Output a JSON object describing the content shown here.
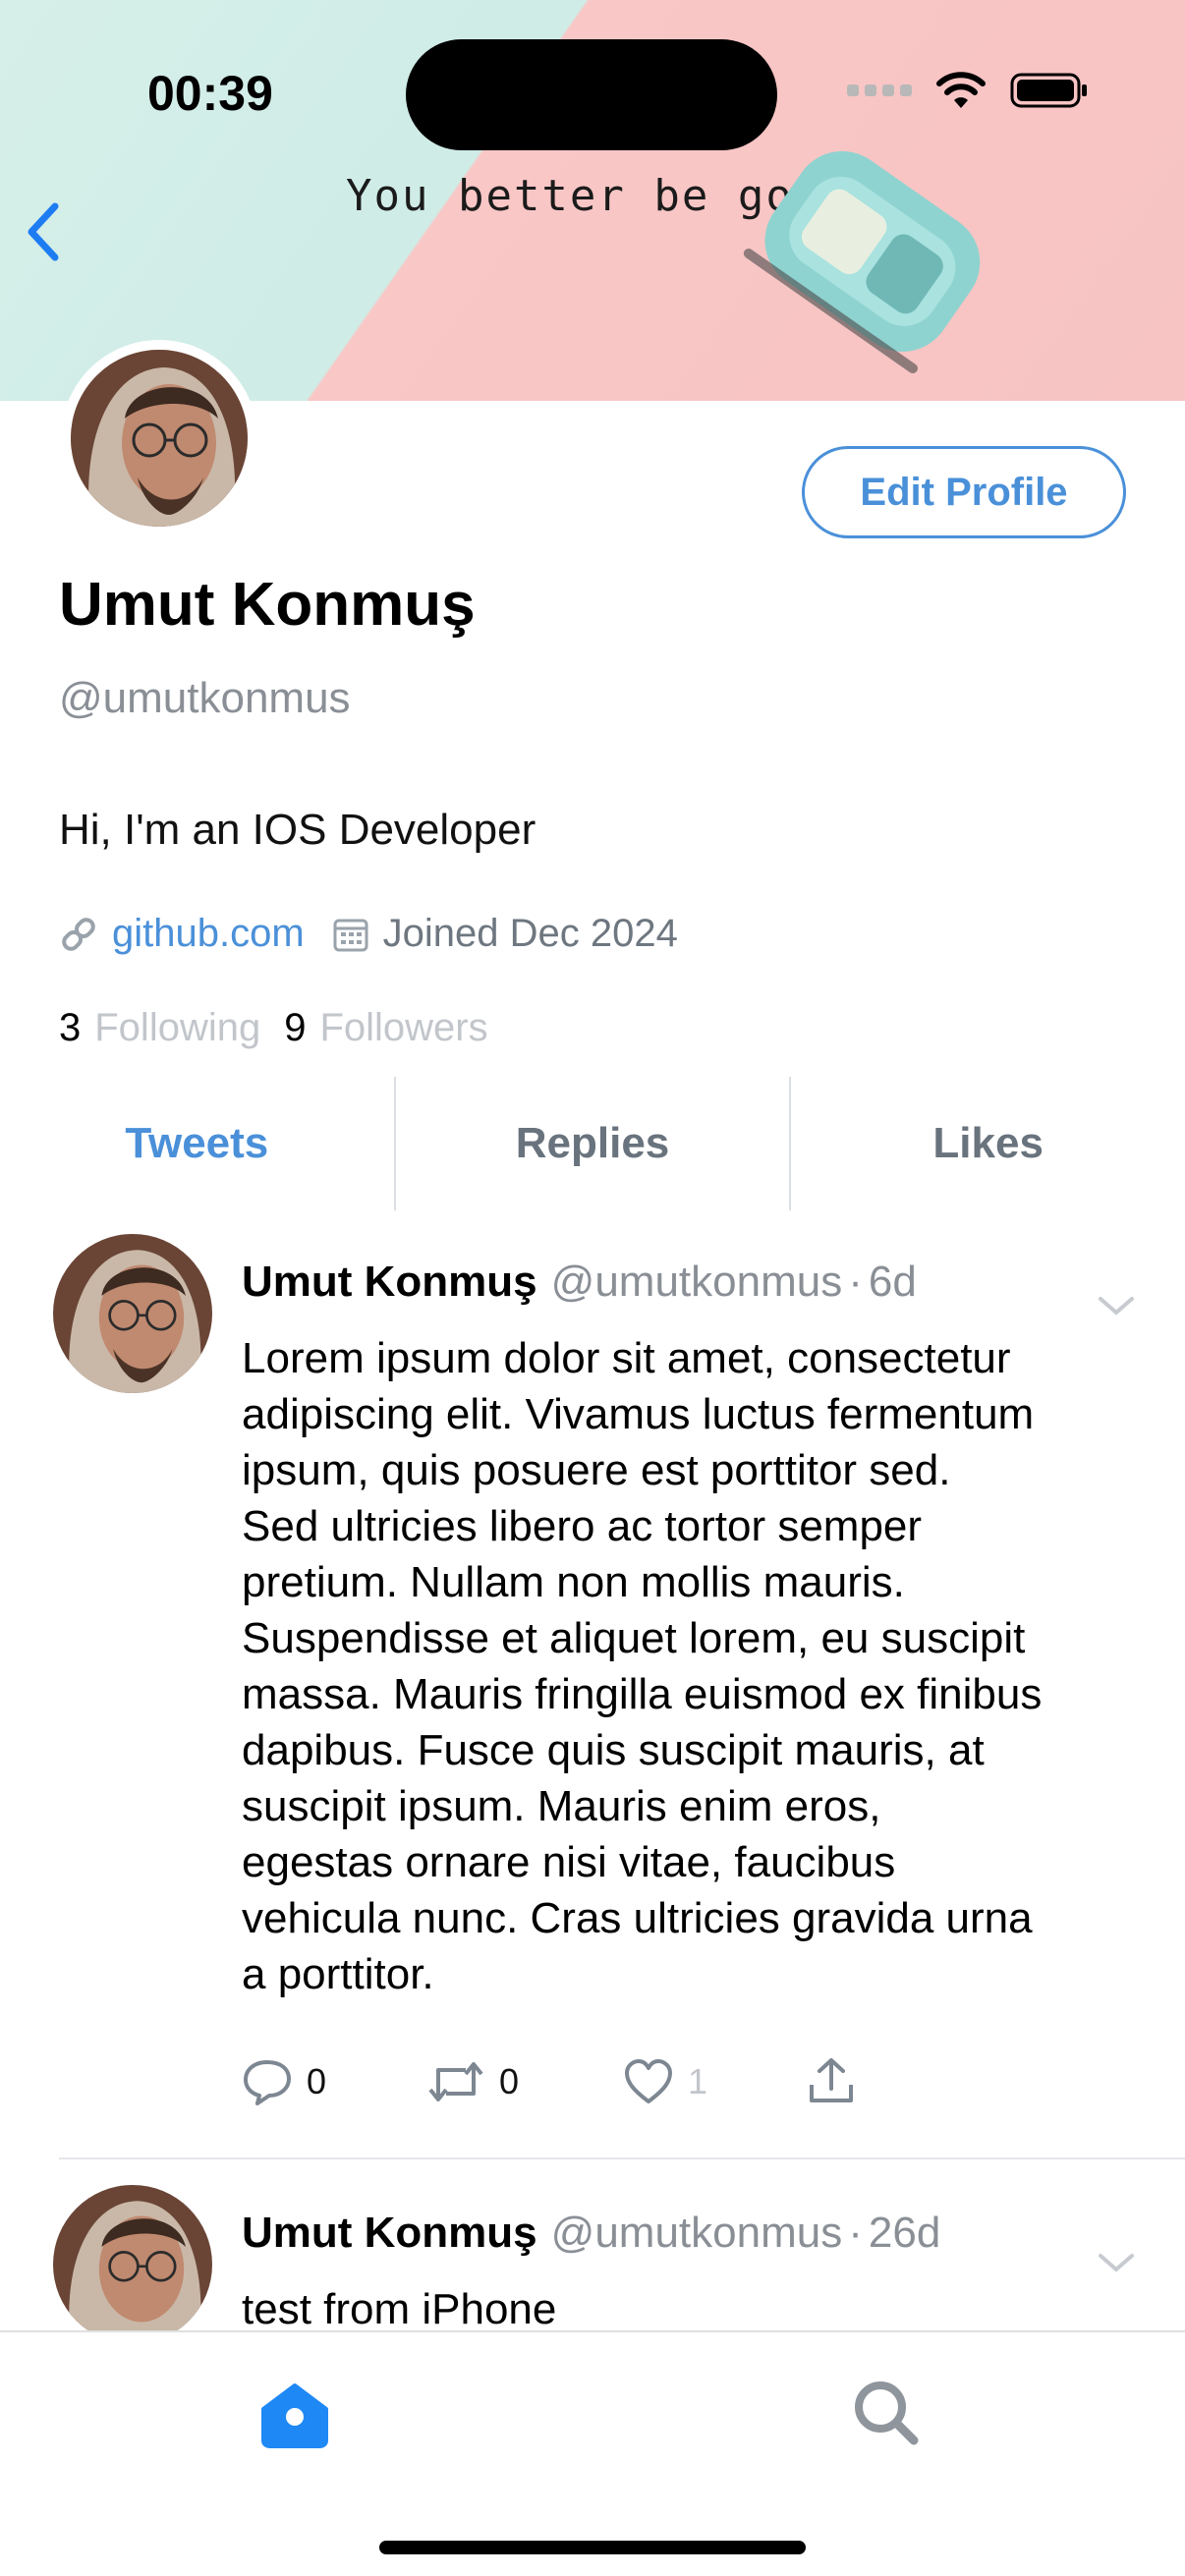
{
  "status_bar": {
    "time": "00:39"
  },
  "banner": {
    "caption": "You better be good!"
  },
  "profile": {
    "display_name": "Umut Konmuş",
    "handle": "@umutkonmus",
    "bio": "Hi, I'm an IOS Developer",
    "link": "github.com",
    "joined": "Joined Dec 2024",
    "following_count": "3",
    "following_label": "Following",
    "followers_count": "9",
    "followers_label": "Followers",
    "edit_button": "Edit Profile"
  },
  "tabs": [
    {
      "label": "Tweets",
      "active": true
    },
    {
      "label": "Replies",
      "active": false
    },
    {
      "label": "Likes",
      "active": false
    }
  ],
  "tweets": [
    {
      "name": "Umut Konmuş",
      "handle": "@umutkonmus",
      "time": "6d",
      "lines": [
        "Lorem ipsum dolor sit amet, consectetur",
        "adipiscing elit. Vivamus luctus fermentum",
        "ipsum, quis posuere est porttitor sed.",
        "Sed ultricies libero ac tortor semper",
        "pretium. Nullam non mollis mauris.",
        "Suspendisse et aliquet lorem, eu suscipit",
        "massa. Mauris fringilla euismod ex finibus",
        "dapibus. Fusce quis suscipit mauris, at",
        "suscipit ipsum. Mauris enim eros,",
        "egestas ornare nisi vitae, faucibus",
        "vehicula nunc. Cras ultricies gravida urna",
        "a porttitor."
      ],
      "replies": "0",
      "retweets": "0",
      "likes": "1"
    },
    {
      "name": "Umut Konmuş",
      "handle": "@umutkonmus",
      "time": "26d",
      "lines": [
        "test from iPhone"
      ]
    }
  ],
  "colors": {
    "accent": "#4a90d9",
    "secondary_text": "#8a8f96",
    "banner_mint": "#cfece6",
    "banner_pink": "#f7c3c3"
  },
  "icons": [
    "back-chevron-icon",
    "wifi-icon",
    "battery-icon",
    "link-icon",
    "calendar-icon",
    "reply-icon",
    "retweet-icon",
    "heart-icon",
    "share-icon",
    "chevron-down-icon",
    "home-icon",
    "search-icon"
  ]
}
